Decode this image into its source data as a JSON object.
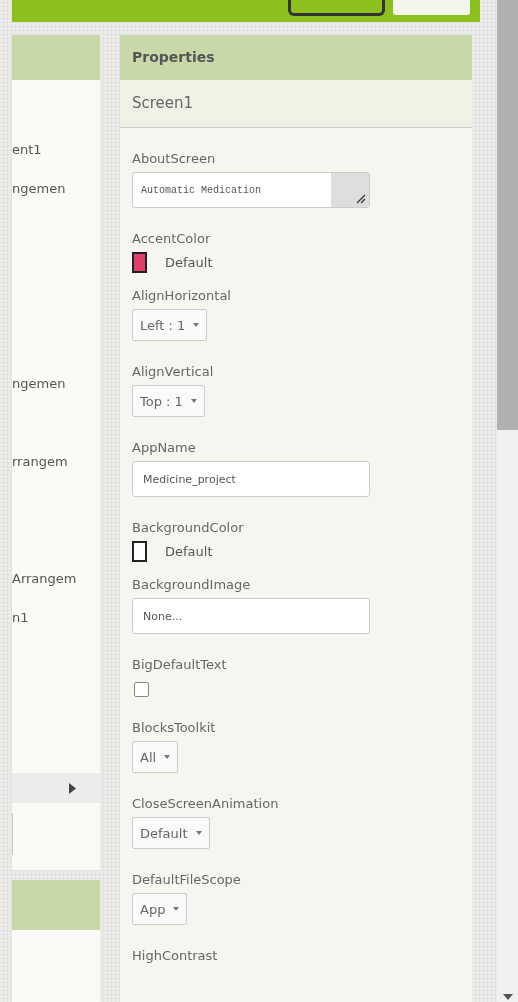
{
  "components_panel": {
    "items": [
      {
        "text": "ent1"
      },
      {
        "text": "ngemen"
      },
      {
        "text": "ngemen"
      },
      {
        "text": "rrangem"
      },
      {
        "text": "Arrangem"
      },
      {
        "text": "n1"
      }
    ]
  },
  "properties_panel": {
    "title": "Properties",
    "component": "Screen1",
    "properties": [
      {
        "label": "AboutScreen",
        "kind": "textarea",
        "value": "Automatic Medication"
      },
      {
        "label": "AccentColor",
        "kind": "color",
        "color": "#e0406a",
        "value": "Default"
      },
      {
        "label": "AlignHorizontal",
        "kind": "dropdown",
        "value": "Left : 1"
      },
      {
        "label": "AlignVertical",
        "kind": "dropdown",
        "value": "Top : 1"
      },
      {
        "label": "AppName",
        "kind": "text",
        "value": "Medicine_project"
      },
      {
        "label": "BackgroundColor",
        "kind": "color",
        "color": "#ffffff",
        "value": "Default"
      },
      {
        "label": "BackgroundImage",
        "kind": "text",
        "value": "None..."
      },
      {
        "label": "BigDefaultText",
        "kind": "checkbox",
        "checked": false
      },
      {
        "label": "BlocksToolkit",
        "kind": "dropdown",
        "value": "All"
      },
      {
        "label": "CloseScreenAnimation",
        "kind": "dropdown",
        "value": "Default"
      },
      {
        "label": "DefaultFileScope",
        "kind": "dropdown",
        "value": "App"
      },
      {
        "label": "HighContrast",
        "kind": "label"
      }
    ]
  }
}
